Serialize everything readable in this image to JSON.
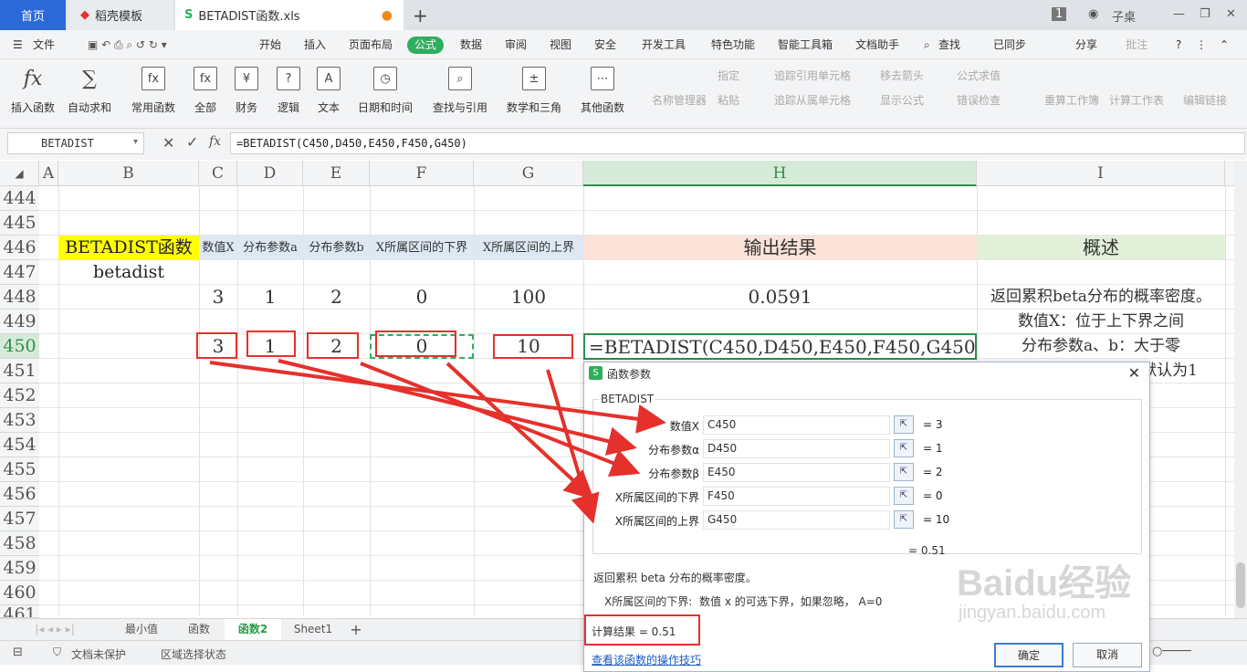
{
  "tabs": {
    "home": "首页",
    "wps_template": "稻壳模板",
    "file": "BETADIST函数.xls"
  },
  "window": {
    "page_badge": "1",
    "user": "子桌"
  },
  "menu": [
    "文件",
    "开始",
    "插入",
    "页面布局",
    "公式",
    "数据",
    "审阅",
    "视图",
    "安全",
    "开发工具",
    "特色功能",
    "智能工具箱",
    "文档助手",
    "查找",
    "已同步",
    "分享",
    "批注"
  ],
  "ribbon": {
    "buttons": [
      "插入函数",
      "自动求和",
      "常用函数",
      "全部",
      "财务",
      "逻辑",
      "文本",
      "日期和时间",
      "查找与引用",
      "数学和三角",
      "其他函数"
    ],
    "disabled": [
      "名称管理器",
      "指定",
      "粘贴",
      "追踪引用单元格",
      "追踪从属单元格",
      "移去箭头",
      "显示公式",
      "公式求值",
      "错误检查",
      "重算工作簿",
      "计算工作表",
      "编辑链接"
    ]
  },
  "formula_bar": {
    "name_box": "BETADIST",
    "fx": "fx",
    "formula": "=BETADIST(C450,D450,E450,F450,G450)"
  },
  "columns": [
    "A",
    "B",
    "C",
    "D",
    "E",
    "F",
    "G",
    "H",
    "I"
  ],
  "rows": [
    "444",
    "445",
    "446",
    "447",
    "448",
    "449",
    "450",
    "451",
    "452",
    "453",
    "454",
    "455",
    "456",
    "457",
    "458",
    "459",
    "460",
    "461"
  ],
  "sheet": {
    "b446": "BETADIST函数",
    "b447": "betadist",
    "headers": [
      "数值X",
      "分布参数a",
      "分布参数b",
      "X所属区间的下界",
      "X所属区间的上界"
    ],
    "h446": "输出结果",
    "i446": "概述",
    "row448": [
      "3",
      "1",
      "2",
      "0",
      "100"
    ],
    "h448": "0.0591",
    "i448": "返回累积beta分布的概率密度。",
    "i449": "数值X：位于上下界之间",
    "row450": [
      "3",
      "1",
      "2",
      "0",
      "10"
    ],
    "h450": "=BETADIST(C450,D450,E450,F450,G450)",
    "i450": "分布参数a、b：大于零",
    "i451": "默认为1"
  },
  "sheet_tabs": [
    "最小值",
    "函数",
    "函数2",
    "Sheet1"
  ],
  "status": {
    "protect": "文档未保护",
    "select_state": "区域选择状态"
  },
  "dialog": {
    "title": "函数参数",
    "func": "BETADIST",
    "args": [
      {
        "label": "数值X",
        "input": "C450",
        "value": "= 3"
      },
      {
        "label": "分布参数α",
        "input": "D450",
        "value": "= 1"
      },
      {
        "label": "分布参数β",
        "input": "E450",
        "value": "= 2"
      },
      {
        "label": "X所属区间的下界",
        "input": "F450",
        "value": "= 0"
      },
      {
        "label": "X所属区间的上界",
        "input": "G450",
        "value": "= 10"
      }
    ],
    "result_eq": "= 0.51",
    "description": "返回累积 beta 分布的概率密度。",
    "arg_help_label": "X所属区间的下界:",
    "arg_help": "数值 x 的可选下界，如果忽略， A=0",
    "calc_result": "计算结果 = 0.51",
    "tips_link": "查看该函数的操作技巧",
    "ok": "确定",
    "cancel": "取消"
  },
  "watermark": {
    "brand": "Baidu经验",
    "url": "jingyan.baidu.com"
  },
  "colors": {
    "accent_green": "#2fae5d",
    "annotation_red": "#e5302b",
    "yellow": "#ffff00",
    "header_blue": "#dde8f3",
    "result_pink": "#fbe3d9",
    "summary_green": "#e2efd9"
  }
}
